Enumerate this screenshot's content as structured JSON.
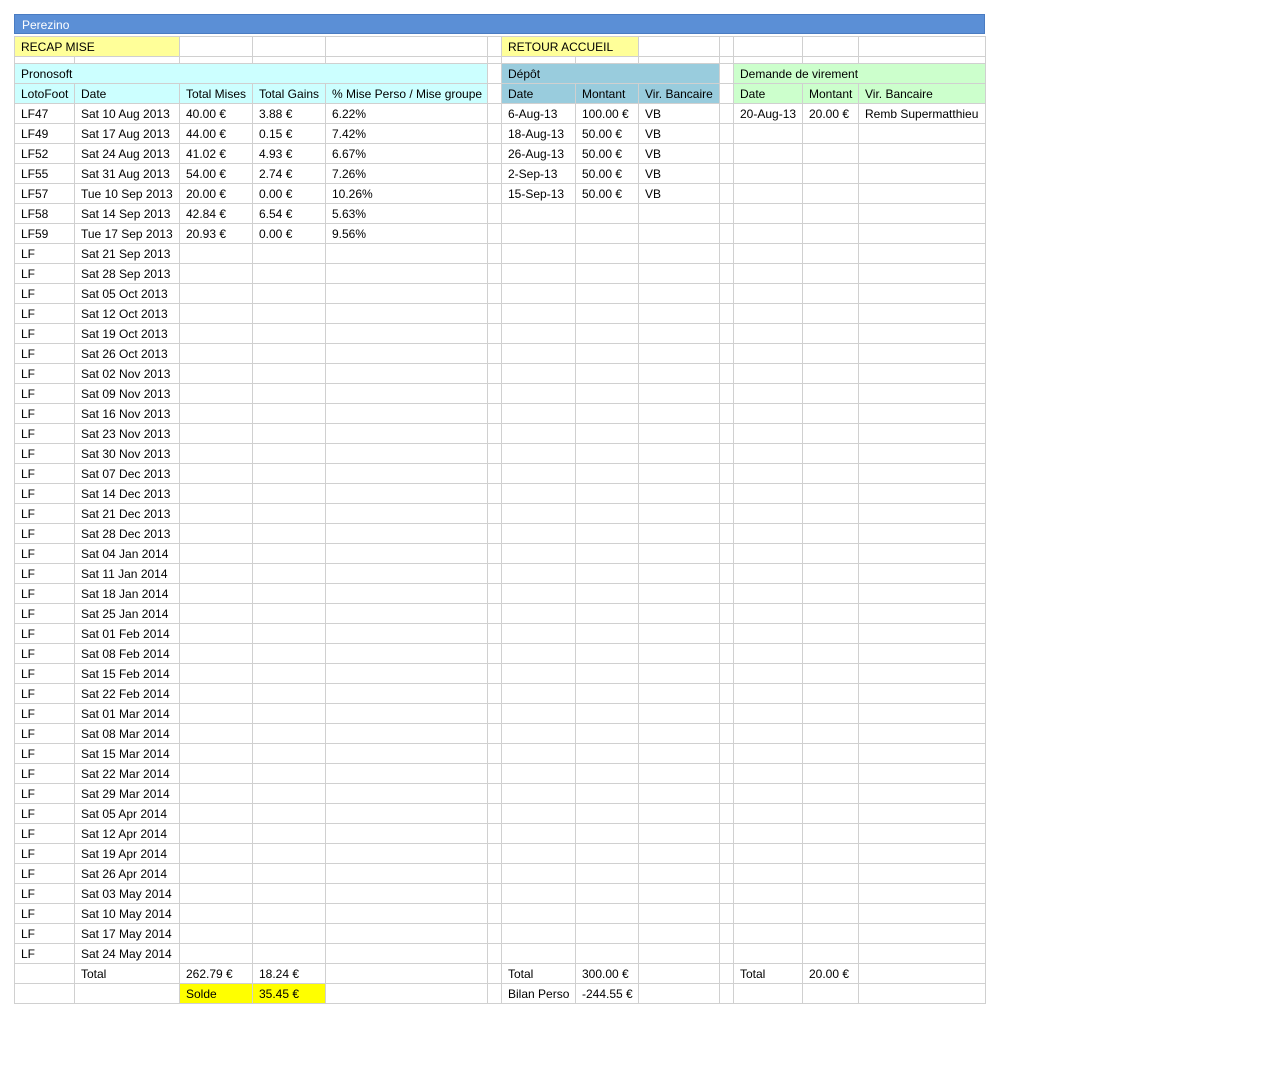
{
  "title": "Perezino",
  "links": {
    "recap": "RECAP MISE",
    "retour": "RETOUR ACCUEIL"
  },
  "sections": {
    "pronosoft": "Pronosoft",
    "depot": "Dépôt",
    "virement": "Demande de virement"
  },
  "headers": {
    "pronosoft": [
      "LotoFoot",
      "Date",
      "Total Mises",
      "Total Gains",
      "% Mise Perso / Mise groupe"
    ],
    "depot": [
      "Date",
      "Montant",
      "Vir. Bancaire"
    ],
    "virement": [
      "Date",
      "Montant",
      "Vir. Bancaire"
    ]
  },
  "rows": [
    {
      "lf": "LF47",
      "date": "Sat 10 Aug 2013",
      "mises": "40.00 €",
      "gains": "3.88 €",
      "pct": "6.22%"
    },
    {
      "lf": "LF49",
      "date": "Sat 17 Aug 2013",
      "mises": "44.00 €",
      "gains": "0.15 €",
      "pct": "7.42%"
    },
    {
      "lf": "LF52",
      "date": "Sat 24 Aug 2013",
      "mises": "41.02 €",
      "gains": "4.93 €",
      "pct": "6.67%"
    },
    {
      "lf": "LF55",
      "date": "Sat 31 Aug 2013",
      "mises": "54.00 €",
      "gains": "2.74 €",
      "pct": "7.26%"
    },
    {
      "lf": "LF57",
      "date": "Tue 10 Sep 2013",
      "mises": "20.00 €",
      "gains": "0.00 €",
      "pct": "10.26%"
    },
    {
      "lf": "LF58",
      "date": "Sat 14 Sep 2013",
      "mises": "42.84 €",
      "gains": "6.54 €",
      "pct": "5.63%"
    },
    {
      "lf": "LF59",
      "date": "Tue 17 Sep 2013",
      "mises": "20.93 €",
      "gains": "0.00 €",
      "pct": "9.56%"
    },
    {
      "lf": "LF",
      "date": "Sat 21 Sep 2013"
    },
    {
      "lf": "LF",
      "date": "Sat 28 Sep 2013"
    },
    {
      "lf": "LF",
      "date": "Sat 05 Oct 2013"
    },
    {
      "lf": "LF",
      "date": "Sat 12 Oct 2013"
    },
    {
      "lf": "LF",
      "date": "Sat 19 Oct 2013"
    },
    {
      "lf": "LF",
      "date": "Sat 26 Oct 2013"
    },
    {
      "lf": "LF",
      "date": "Sat 02 Nov 2013"
    },
    {
      "lf": "LF",
      "date": "Sat 09 Nov 2013"
    },
    {
      "lf": "LF",
      "date": "Sat 16 Nov 2013"
    },
    {
      "lf": "LF",
      "date": "Sat 23 Nov 2013"
    },
    {
      "lf": "LF",
      "date": "Sat 30 Nov 2013"
    },
    {
      "lf": "LF",
      "date": "Sat 07 Dec 2013"
    },
    {
      "lf": "LF",
      "date": "Sat 14 Dec 2013"
    },
    {
      "lf": "LF",
      "date": "Sat 21 Dec 2013"
    },
    {
      "lf": "LF",
      "date": "Sat 28 Dec 2013"
    },
    {
      "lf": "LF",
      "date": "Sat 04 Jan 2014"
    },
    {
      "lf": "LF",
      "date": "Sat 11 Jan 2014"
    },
    {
      "lf": "LF",
      "date": "Sat 18 Jan 2014"
    },
    {
      "lf": "LF",
      "date": "Sat 25 Jan 2014"
    },
    {
      "lf": "LF",
      "date": "Sat 01 Feb 2014"
    },
    {
      "lf": "LF",
      "date": "Sat 08 Feb 2014"
    },
    {
      "lf": "LF",
      "date": "Sat 15 Feb 2014"
    },
    {
      "lf": "LF",
      "date": "Sat 22 Feb 2014"
    },
    {
      "lf": "LF",
      "date": "Sat 01 Mar 2014"
    },
    {
      "lf": "LF",
      "date": "Sat 08 Mar 2014"
    },
    {
      "lf": "LF",
      "date": "Sat 15 Mar 2014"
    },
    {
      "lf": "LF",
      "date": "Sat 22 Mar 2014"
    },
    {
      "lf": "LF",
      "date": "Sat 29 Mar 2014"
    },
    {
      "lf": "LF",
      "date": "Sat 05 Apr 2014"
    },
    {
      "lf": "LF",
      "date": "Sat 12 Apr 2014"
    },
    {
      "lf": "LF",
      "date": "Sat 19 Apr 2014"
    },
    {
      "lf": "LF",
      "date": "Sat 26 Apr 2014"
    },
    {
      "lf": "LF",
      "date": "Sat 03 May 2014"
    },
    {
      "lf": "LF",
      "date": "Sat 10 May 2014"
    },
    {
      "lf": "LF",
      "date": "Sat 17 May 2014"
    },
    {
      "lf": "LF",
      "date": "Sat 24 May 2014"
    }
  ],
  "depots": [
    {
      "date": "6-Aug-13",
      "montant": "100.00 €",
      "vir": "VB"
    },
    {
      "date": "18-Aug-13",
      "montant": "50.00 €",
      "vir": "VB"
    },
    {
      "date": "26-Aug-13",
      "montant": "50.00 €",
      "vir": "VB"
    },
    {
      "date": "2-Sep-13",
      "montant": "50.00 €",
      "vir": "VB"
    },
    {
      "date": "15-Sep-13",
      "montant": "50.00 €",
      "vir": "VB"
    }
  ],
  "virements": [
    {
      "date": "20-Aug-13",
      "montant": "20.00 €",
      "vir": "Remb Supermatthieu"
    }
  ],
  "totals": {
    "label": "Total",
    "mises": "262.79 €",
    "gains": "18.24 €",
    "depot_label": "Total",
    "depot": "300.00 €",
    "virement_label": "Total",
    "virement": "20.00 €"
  },
  "solde": {
    "label": "Solde",
    "value": "35.45 €"
  },
  "bilan": {
    "label": "Bilan Perso",
    "value": "-244.55 €"
  }
}
